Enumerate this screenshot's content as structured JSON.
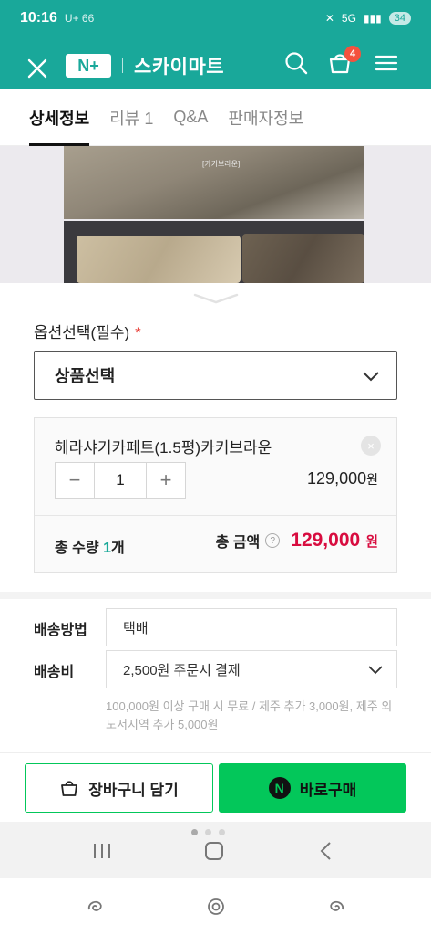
{
  "status_bar": {
    "time": "10:16",
    "left_icons": "U+ 66",
    "network": "5G",
    "battery": "34"
  },
  "header": {
    "logo_text": "N+",
    "store_name": "스카이마트",
    "cart_count": "4",
    "accent_color": "#19a89a"
  },
  "tabs": [
    {
      "label": "상세정보",
      "active": true
    },
    {
      "label": "리뷰 1",
      "active": false
    },
    {
      "label": "Q&A",
      "active": false
    },
    {
      "label": "판매자정보",
      "active": false
    }
  ],
  "product_image": {
    "caption": "[카키브라운]"
  },
  "option": {
    "label": "옵션선택(필수)",
    "required_mark": "*",
    "select_value": "상품선택"
  },
  "selected_item": {
    "name": "헤라샤기카페트(1.5평)카키브라운",
    "quantity": "1",
    "price": "129,000",
    "price_unit": "원",
    "remove_symbol": "×"
  },
  "totals": {
    "qty_label": "총 수량",
    "qty_value": "1",
    "qty_unit": "개",
    "amount_label": "총 금액",
    "help_symbol": "?",
    "amount_value": "129,000",
    "amount_unit": "원",
    "amount_color": "#d80c3f"
  },
  "shipping": {
    "method_label": "배송방법",
    "method_value": "택배",
    "fee_label": "배송비",
    "fee_value": "2,500원 주문시 결제",
    "note": "100,000원 이상 구매 시 무료 / 제주 추가 3,000원, 제주 외 도서지역 추가 5,000원"
  },
  "actions": {
    "cart_label": "장바구니 담기",
    "buy_label": "바로구매",
    "buy_badge": "N",
    "buy_color": "#03c75a"
  }
}
